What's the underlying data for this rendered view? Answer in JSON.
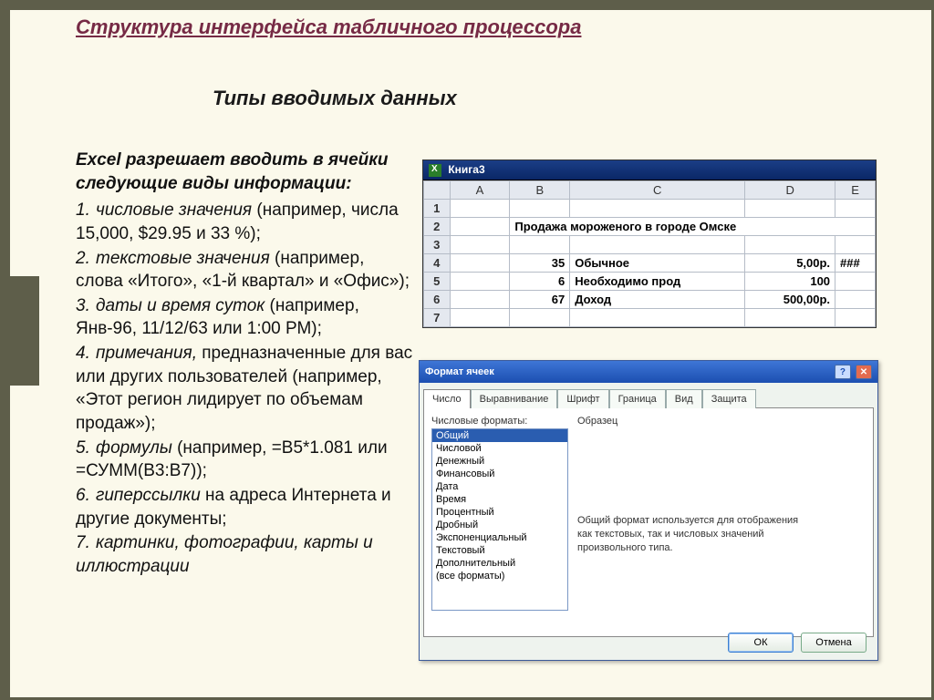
{
  "page": {
    "title": "Структура интерфейса табличного процессора",
    "section": "Типы вводимых данных",
    "lead": "Excel разрешает вводить в ячейки следующие виды информации:",
    "items": [
      {
        "n": "1.",
        "term": "числовые значения",
        "rest": " (например, числа 15,000, $29.95 и 33 %);"
      },
      {
        "n": "2.",
        "term": "текстовые значения",
        "rest": " (например, слова «Итого», «1-й квартал» и «Офис»);"
      },
      {
        "n": "3.",
        "term": "даты и время суток",
        "rest": " (например, Янв-96, 11/12/63 или 1:00 РМ);"
      },
      {
        "n": "4.",
        "term": "примечания,",
        "rest": " предназначенные для вас или других пользователей (например,  «Этот регион лидирует по  объемам  продаж»);"
      },
      {
        "n": "5.",
        "term": "формулы",
        "rest": " (например, =В5*1.081 или =СУММ(В3:В7));"
      },
      {
        "n": "6.",
        "term": "гиперссылки",
        "rest": " на адреса Интернета и другие документы;"
      },
      {
        "n": "7.",
        "term": "картинки, фотографии, карты и иллюстрации",
        "rest": ""
      }
    ]
  },
  "excel": {
    "title": "Книга3",
    "cols": [
      "",
      "A",
      "B",
      "C",
      "D",
      "E"
    ],
    "rows": [
      "1",
      "2",
      "3",
      "4",
      "5",
      "6",
      "7"
    ],
    "r2b": "Продажа мороженого в городе Омске",
    "r4": {
      "A": "",
      "B": "35",
      "C": "Обычное",
      "D": "5,00р.",
      "E": "###"
    },
    "r5": {
      "A": "",
      "B": "6",
      "C": "Необходимо прод",
      "D": "100",
      "E": ""
    },
    "r6": {
      "A": "",
      "B": "67",
      "C": "Доход",
      "D": "500,00р.",
      "E": ""
    }
  },
  "dlg": {
    "title": "Формат ячеек",
    "tabs": [
      "Число",
      "Выравнивание",
      "Шрифт",
      "Граница",
      "Вид",
      "Защита"
    ],
    "list_label": "Числовые форматы:",
    "formats": [
      "Общий",
      "Числовой",
      "Денежный",
      "Финансовый",
      "Дата",
      "Время",
      "Процентный",
      "Дробный",
      "Экспоненциальный",
      "Текстовый",
      "Дополнительный",
      "(все форматы)"
    ],
    "preview_label": "Образец",
    "desc": "Общий формат используется для отображения как текстовых, так и числовых значений произвольного типа.",
    "ok": "ОК",
    "cancel": "Отмена"
  }
}
